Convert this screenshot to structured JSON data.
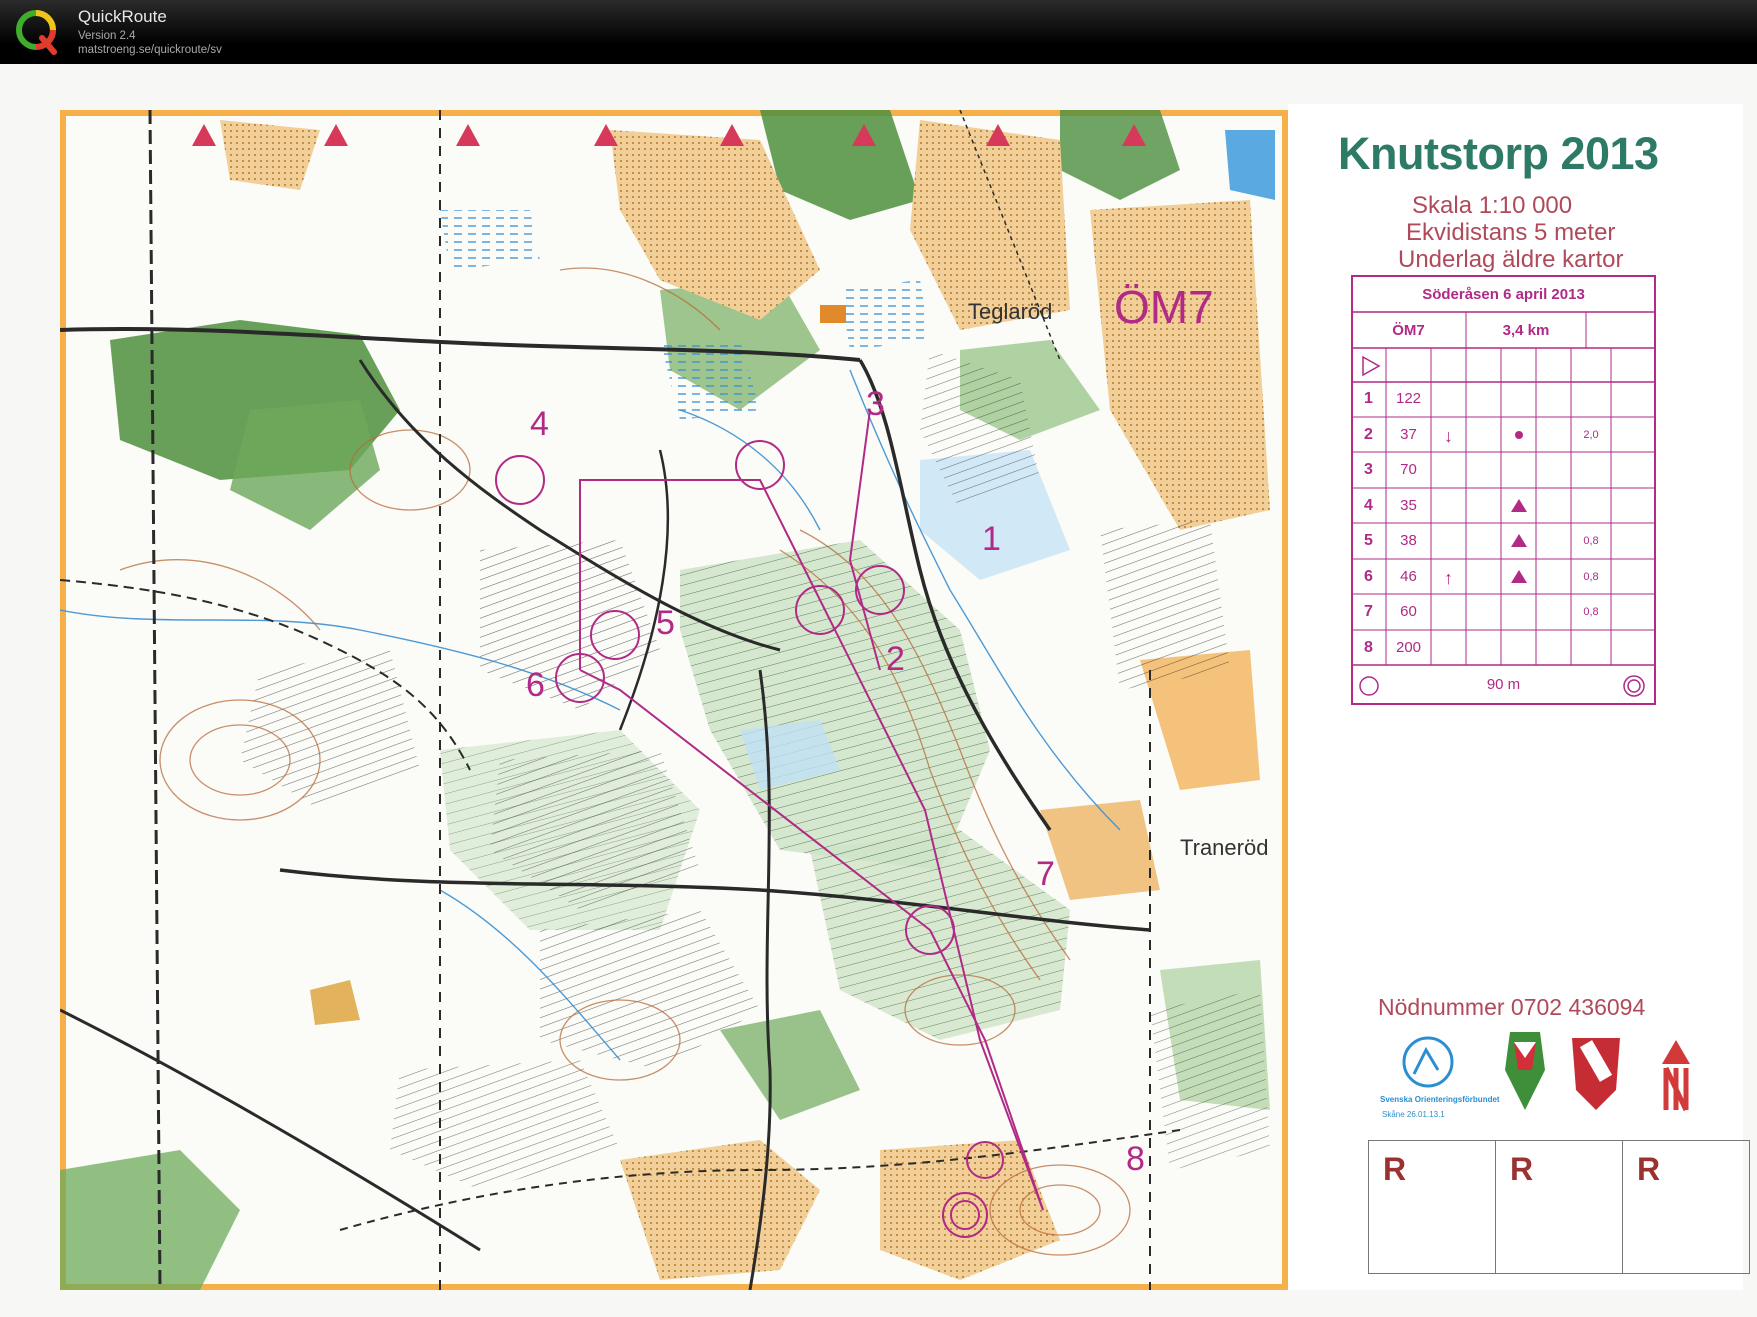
{
  "app": {
    "name": "QuickRoute",
    "version": "Version 2.4",
    "url": "matstroeng.se/quickroute/sv"
  },
  "map": {
    "title": "Knutstorp 2013",
    "scale": "Skala 1:10 000",
    "contour": "Ekvidistans 5 meter",
    "base": "Underlag äldre kartor",
    "class_label": "ÖM7",
    "places": {
      "teglarod": "Teglaröd",
      "tranerod": "Traneröd"
    },
    "controls": [
      "1",
      "2",
      "3",
      "4",
      "5",
      "6",
      "7",
      "8"
    ],
    "emergency": "Nödnummer 0702 436094",
    "federation": "Svenska Orienteringsförbundet",
    "approval": "Skåne 26.01.13.1",
    "r_labels": [
      "R",
      "R",
      "R"
    ],
    "colors": {
      "title": "#2d7a67",
      "course": "#b02a86",
      "frame": "#f5b04a",
      "forest": "#4e8f3e"
    }
  },
  "descriptions": {
    "event": "Söderåsen 6 april 2013",
    "class": "ÖM7",
    "length": "3,4 km",
    "rows": [
      {
        "num": "1",
        "code": "122",
        "dir": "",
        "dim": ""
      },
      {
        "num": "2",
        "code": "37",
        "dir": "↓",
        "dim": "2,0"
      },
      {
        "num": "3",
        "code": "70",
        "dir": "",
        "dim": ""
      },
      {
        "num": "4",
        "code": "35",
        "dir": "",
        "dim": ""
      },
      {
        "num": "5",
        "code": "38",
        "dir": "",
        "dim": "0,8"
      },
      {
        "num": "6",
        "code": "46",
        "dir": "↑",
        "dim": "0,8"
      },
      {
        "num": "7",
        "code": "60",
        "dir": "",
        "dim": "0,8"
      },
      {
        "num": "8",
        "code": "200",
        "dir": "",
        "dim": ""
      }
    ],
    "finish": "90 m"
  }
}
